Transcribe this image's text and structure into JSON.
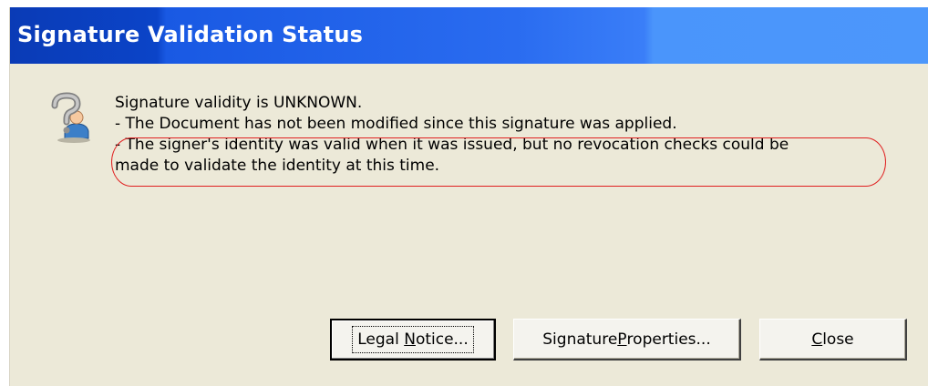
{
  "window": {
    "title": "Signature Validation Status"
  },
  "icon": {
    "name": "signature-unknown-icon"
  },
  "message": {
    "line1": "Signature validity is UNKNOWN.",
    "line2": "- The Document has not been modified since this signature was applied.",
    "line3": "- The signer's identity was valid when it was issued, but no revocation checks could be",
    "line4": "made to validate the identity at this time."
  },
  "buttons": {
    "legal_notice": {
      "before": "Legal ",
      "mnemonic": "N",
      "after": "otice..."
    },
    "signature_properties": {
      "before": "Signature ",
      "mnemonic": "P",
      "after": "roperties..."
    },
    "close": {
      "before": "",
      "mnemonic": "C",
      "after": "lose"
    }
  },
  "colors": {
    "dialog_background": "#ece9d8",
    "titlebar_start": "#0a3bb6",
    "titlebar_end": "#4c97fb",
    "highlight_oval": "#e02020"
  }
}
